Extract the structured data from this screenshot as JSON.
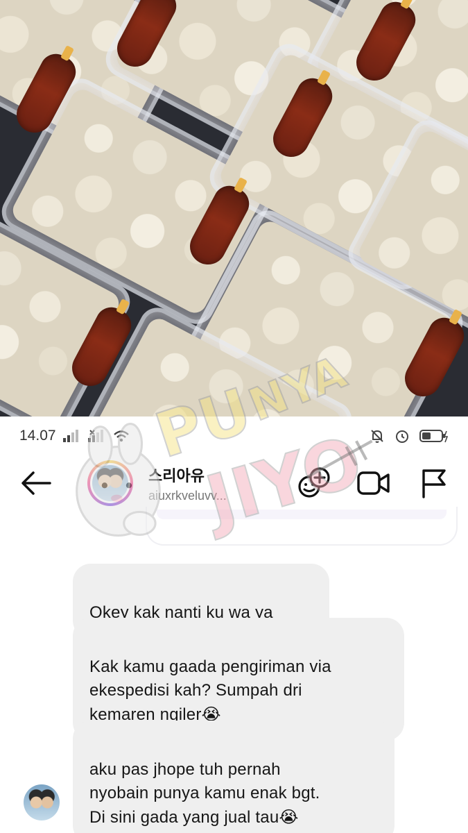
{
  "photo": {
    "description_icon": "food-photo",
    "watermark_text": "PUNYAJIYOO"
  },
  "status_bar": {
    "time": "14.07",
    "battery_icon": "battery-icon",
    "signal_icon": "signal-icon",
    "wifi_icon": "wifi-icon",
    "mute_icon": "bell-off-icon",
    "alarm_icon": "alarm-icon"
  },
  "header": {
    "username": "스리아유",
    "handle": "aiuxrkveluvv...",
    "icons": [
      "back-arrow-icon",
      "add-people-icon",
      "video-call-icon",
      "flag-icon"
    ]
  },
  "messages": [
    {
      "text": "Okey kak nanti ku wa ya",
      "emoji": ""
    },
    {
      "text": "Kak kamu gaada pengiriman via\nekespedisi kah? Sumpah dri\nkemaren ngiler",
      "emoji": "😭"
    },
    {
      "text": "aku pas jhope tuh pernah\nnyobain punya kamu enak bgt.\nDi sini gada yang jual tau",
      "emoji": "😭"
    }
  ],
  "colors": {
    "bubble": "#efefef",
    "background": "#ffffff",
    "watermark_yellow": "#f4e27a",
    "watermark_pink": "#f2a6b4"
  }
}
